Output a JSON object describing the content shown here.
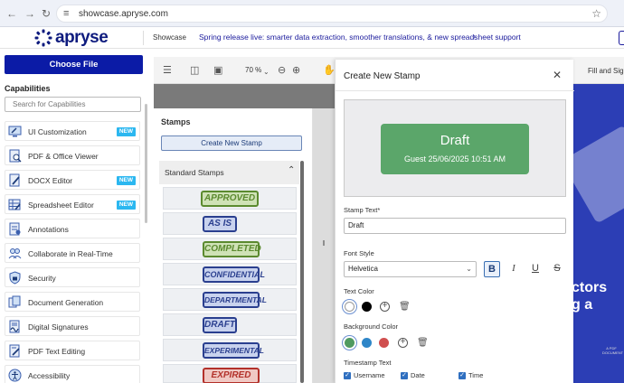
{
  "browser": {
    "url": "showcase.apryse.com",
    "back_icon": "arrow-left-icon",
    "forward_icon": "arrow-right-icon",
    "reload_icon": "reload-icon"
  },
  "header": {
    "logo_text": "apryse",
    "showcase_label": "Showcase",
    "release_text": "Spring release live: smarter data extraction, smoother translations, & new spreadsheet support",
    "release_chevron": "›"
  },
  "sidebar": {
    "choose_file_label": "Choose File",
    "capabilities_title": "Capabilities",
    "search_placeholder": "Search for Capabilities",
    "items": [
      {
        "label": "UI Customization",
        "badge": "NEW"
      },
      {
        "label": "PDF & Office Viewer",
        "badge": ""
      },
      {
        "label": "DOCX Editor",
        "badge": "NEW"
      },
      {
        "label": "Spreadsheet Editor",
        "badge": "NEW"
      },
      {
        "label": "Annotations",
        "badge": ""
      },
      {
        "label": "Collaborate in Real-Time",
        "badge": ""
      },
      {
        "label": "Security",
        "badge": ""
      },
      {
        "label": "Document Generation",
        "badge": ""
      },
      {
        "label": "Digital Signatures",
        "badge": ""
      },
      {
        "label": "PDF Text Editing",
        "badge": ""
      },
      {
        "label": "Accessibility",
        "badge": ""
      }
    ]
  },
  "viewer": {
    "zoom": "70 %",
    "fill_and_sign": "Fill and Sign",
    "page_text_1": "ctors",
    "page_text_2": "g a",
    "page_tiny": "A PDF DOCUMENT"
  },
  "stamps_panel": {
    "title": "Stamps",
    "create_button": "Create New Stamp",
    "standard_header": "Standard Stamps",
    "stamps": [
      {
        "label": "APPROVED",
        "color": "#5b8a2f",
        "bg": "#cfe2b6"
      },
      {
        "label": "AS IS",
        "color": "#2a3f8f",
        "bg": "#c8d2ee"
      },
      {
        "label": "COMPLETED",
        "color": "#5b8a2f",
        "bg": "#cfe2b6"
      },
      {
        "label": "CONFIDENTIAL",
        "color": "#2a3f8f",
        "bg": "#c8d2ee"
      },
      {
        "label": "DEPARTMENTAL",
        "color": "#2a3f8f",
        "bg": "#c8d2ee"
      },
      {
        "label": "DRAFT",
        "color": "#2a3f8f",
        "bg": "#c8d2ee"
      },
      {
        "label": "EXPERIMENTAL",
        "color": "#2a3f8f",
        "bg": "#c8d2ee"
      },
      {
        "label": "EXPIRED",
        "color": "#b3312a",
        "bg": "#f0c9c4"
      }
    ]
  },
  "modal": {
    "title": "Create New Stamp",
    "preview_text": "Draft",
    "preview_sub": "Guest 25/06/2025 10:51 AM",
    "preview_color": "#5ba66a",
    "stamp_text_label": "Stamp Text*",
    "stamp_text_value": "Draft",
    "font_style_label": "Font Style",
    "font_value": "Helvetica",
    "bold_label": "B",
    "italic_label": "I",
    "underline_label": "U",
    "strike_label": "S",
    "text_color_label": "Text Color",
    "text_colors": [
      "#ffffff",
      "#000000"
    ],
    "bg_color_label": "Background Color",
    "bg_colors": [
      "#4f9a61",
      "#2e86c8",
      "#d04f4f"
    ],
    "timestamp_label": "Timestamp Text",
    "timestamp_options": [
      "Username",
      "Date",
      "Time"
    ]
  }
}
